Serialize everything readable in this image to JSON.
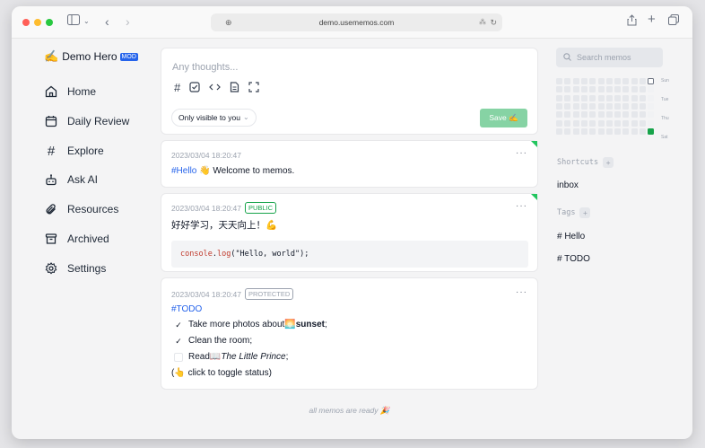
{
  "browser": {
    "url": "demo.usememos.com",
    "buttons": {
      "sidebar_toggle": "sidebar",
      "back": "back",
      "forward": "forward",
      "share": "share",
      "new_tab": "new tab",
      "tabs": "tabs"
    }
  },
  "sidebar": {
    "user_emoji": "✍️",
    "user_name": "Demo Hero",
    "role_badge": "MOD",
    "items": [
      {
        "label": "Home",
        "icon": "home-icon"
      },
      {
        "label": "Daily Review",
        "icon": "calendar-icon"
      },
      {
        "label": "Explore",
        "icon": "hash-icon"
      },
      {
        "label": "Ask AI",
        "icon": "bot-icon"
      },
      {
        "label": "Resources",
        "icon": "paperclip-icon"
      },
      {
        "label": "Archived",
        "icon": "archive-icon"
      },
      {
        "label": "Settings",
        "icon": "gear-icon"
      }
    ]
  },
  "editor": {
    "placeholder": "Any thoughts...",
    "toolbar": [
      "hash-icon",
      "checkbox-icon",
      "code-icon",
      "file-icon",
      "fullscreen-icon"
    ],
    "visibility": "Only visible to you",
    "save_label": "Save ✍️"
  },
  "memos": [
    {
      "time": "2023/03/04 18:20:47",
      "badge": "",
      "tag": "#Hello",
      "emoji": "👋",
      "text": " Welcome to memos."
    },
    {
      "time": "2023/03/04 18:20:47",
      "badge": "PUBLIC",
      "text": "好好学习，天天向上！💪",
      "code_fn": "console",
      "code_dot": ".",
      "code_method": "log",
      "code_open": "(",
      "code_string": "\"Hello, world\"",
      "code_close": ");"
    },
    {
      "time": "2023/03/04 18:20:47",
      "badge": "PROTECTED",
      "tag": "#TODO",
      "tasks": [
        {
          "done": true,
          "prefix": "Take more photos about ",
          "emoji": "🌅",
          "strong": " sunset",
          "suffix": ";"
        },
        {
          "done": true,
          "prefix": "Clean the room;",
          "emoji": "",
          "strong": "",
          "suffix": ""
        },
        {
          "done": false,
          "prefix": "Read ",
          "emoji": "📖",
          "italic": " The Little Prince",
          "suffix": ";"
        }
      ],
      "footer_open": "(",
      "footer_emoji": "👆",
      "footer_text": " click to toggle status)"
    }
  ],
  "footer_text": "all memos are ready 🎉",
  "right": {
    "search_placeholder": "Search memos",
    "heatmap_days": [
      "Sun",
      "Tue",
      "Thu",
      "Sat"
    ],
    "shortcuts_title": "Shortcuts",
    "shortcuts": [
      "inbox"
    ],
    "tags_title": "Tags",
    "tags": [
      "# Hello",
      "# TODO"
    ],
    "add_symbol": "+"
  },
  "colors": {
    "accent": "#2563eb",
    "save_button": "#86d3a4",
    "public": "#16a34a",
    "protected": "#9ca3af",
    "heat_active": "#16a34a"
  }
}
